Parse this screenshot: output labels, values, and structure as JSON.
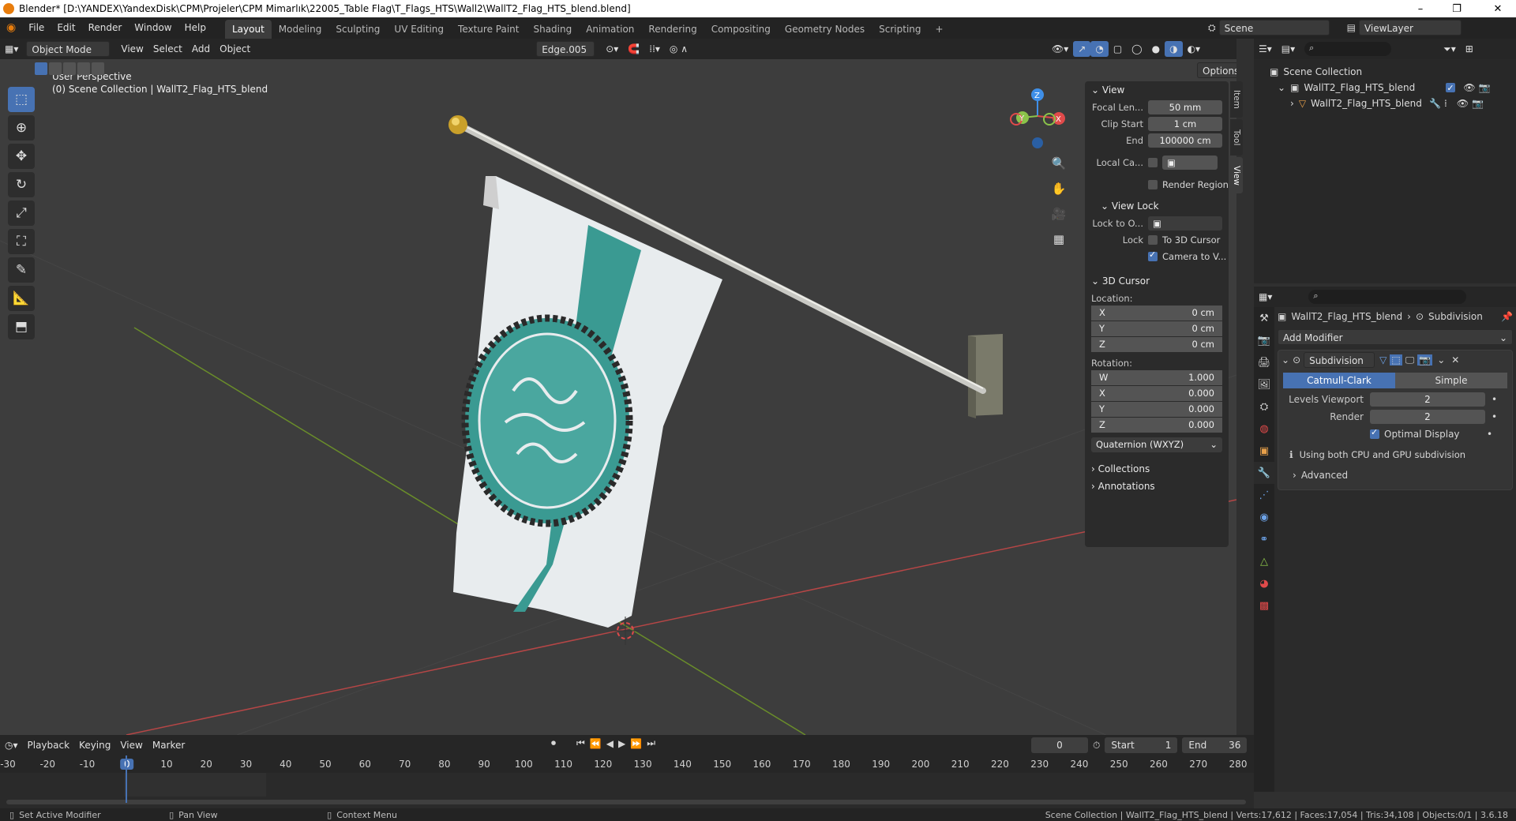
{
  "window": {
    "title": "Blender* [D:\\YANDEX\\YandexDisk\\CPM\\Projeler\\CPM Mimarlık\\22005_Table Flag\\T_Flags_HTS\\Wall2\\WallT2_Flag_HTS_blend.blend]",
    "minimize": "–",
    "restore": "❐",
    "close": "✕"
  },
  "menu": [
    "File",
    "Edit",
    "Render",
    "Window",
    "Help"
  ],
  "workspaces": [
    "Layout",
    "Modeling",
    "Sculpting",
    "UV Editing",
    "Texture Paint",
    "Shading",
    "Animation",
    "Rendering",
    "Compositing",
    "Geometry Nodes",
    "Scripting",
    "+"
  ],
  "scene": {
    "name": "Scene",
    "viewlayer": "ViewLayer"
  },
  "viewport_header": {
    "mode": "Object Mode",
    "menus": [
      "View",
      "Select",
      "Add",
      "Object"
    ],
    "active_object": "Edge.005",
    "options": "Options"
  },
  "viewport": {
    "perspective": "User Perspective",
    "collection_info": "(0) Scene Collection | WallT2_Flag_HTS_blend"
  },
  "gizmo": {
    "x": "X",
    "y": "Y",
    "z": "Z"
  },
  "npanel": {
    "tabs": [
      "Item",
      "Tool",
      "View"
    ],
    "view": {
      "header": "View",
      "focal_label": "Focal Len...",
      "focal": "50 mm",
      "clip_start_label": "Clip Start",
      "clip_start": "1 cm",
      "end_label": "End",
      "clip_end": "100000 cm",
      "local_cam_label": "Local Ca...",
      "render_region": "Render Region"
    },
    "view_lock": {
      "header": "View Lock",
      "lock_to_label": "Lock to O...",
      "lock_label": "Lock",
      "to_3d_cursor": "To 3D Cursor",
      "camera_to_view": "Camera to V..."
    },
    "cursor": {
      "header": "3D Cursor",
      "location_label": "Location:",
      "location": [
        {
          "axis": "X",
          "value": "0 cm"
        },
        {
          "axis": "Y",
          "value": "0 cm"
        },
        {
          "axis": "Z",
          "value": "0 cm"
        }
      ],
      "rotation_label": "Rotation:",
      "rotation": [
        {
          "axis": "W",
          "value": "1.000"
        },
        {
          "axis": "X",
          "value": "0.000"
        },
        {
          "axis": "Y",
          "value": "0.000"
        },
        {
          "axis": "Z",
          "value": "0.000"
        }
      ],
      "rotation_mode": "Quaternion (WXYZ)"
    },
    "collections": "Collections",
    "annotations": "Annotations"
  },
  "outliner": {
    "root": "Scene Collection",
    "collection": "WallT2_Flag_HTS_blend",
    "object": "WallT2_Flag_HTS_blend"
  },
  "properties": {
    "breadcrumb_object": "WallT2_Flag_HTS_blend",
    "breadcrumb_modifier": "Subdivision",
    "add_modifier": "Add Modifier",
    "modifier": {
      "name": "Subdivision",
      "type_a": "Catmull-Clark",
      "type_b": "Simple",
      "levels_viewport_label": "Levels Viewport",
      "levels_viewport": "2",
      "render_label": "Render",
      "render": "2",
      "optimal_display": "Optimal Display",
      "info": "Using both CPU and GPU subdivision",
      "advanced": "Advanced"
    }
  },
  "timeline": {
    "menus": [
      "Playback",
      "Keying",
      "View",
      "Marker"
    ],
    "current_frame": "0",
    "start_label": "Start",
    "start": "1",
    "end_label": "End",
    "end": "36",
    "ticks": [
      "-30",
      "-20",
      "-10",
      "0",
      "10",
      "20",
      "30",
      "40",
      "50",
      "60",
      "70",
      "80",
      "90",
      "100",
      "110",
      "120",
      "130",
      "140",
      "150",
      "160",
      "170",
      "180",
      "190",
      "200",
      "210",
      "220",
      "230",
      "240",
      "250",
      "260",
      "270",
      "280"
    ]
  },
  "statusbar": {
    "left1": "Set Active Modifier",
    "left2": "Pan View",
    "left3": "Context Menu",
    "right": "Scene Collection | WallT2_Flag_HTS_blend | Verts:17,612 | Faces:17,054 | Tris:34,108 | Objects:0/1 | 3.6.18"
  },
  "colors": {
    "accent": "#4772b3",
    "flag_teal": "#3a9a92",
    "x_axis": "#e04a4a",
    "y_axis": "#8bc34a",
    "z_axis": "#3f8fe8"
  }
}
